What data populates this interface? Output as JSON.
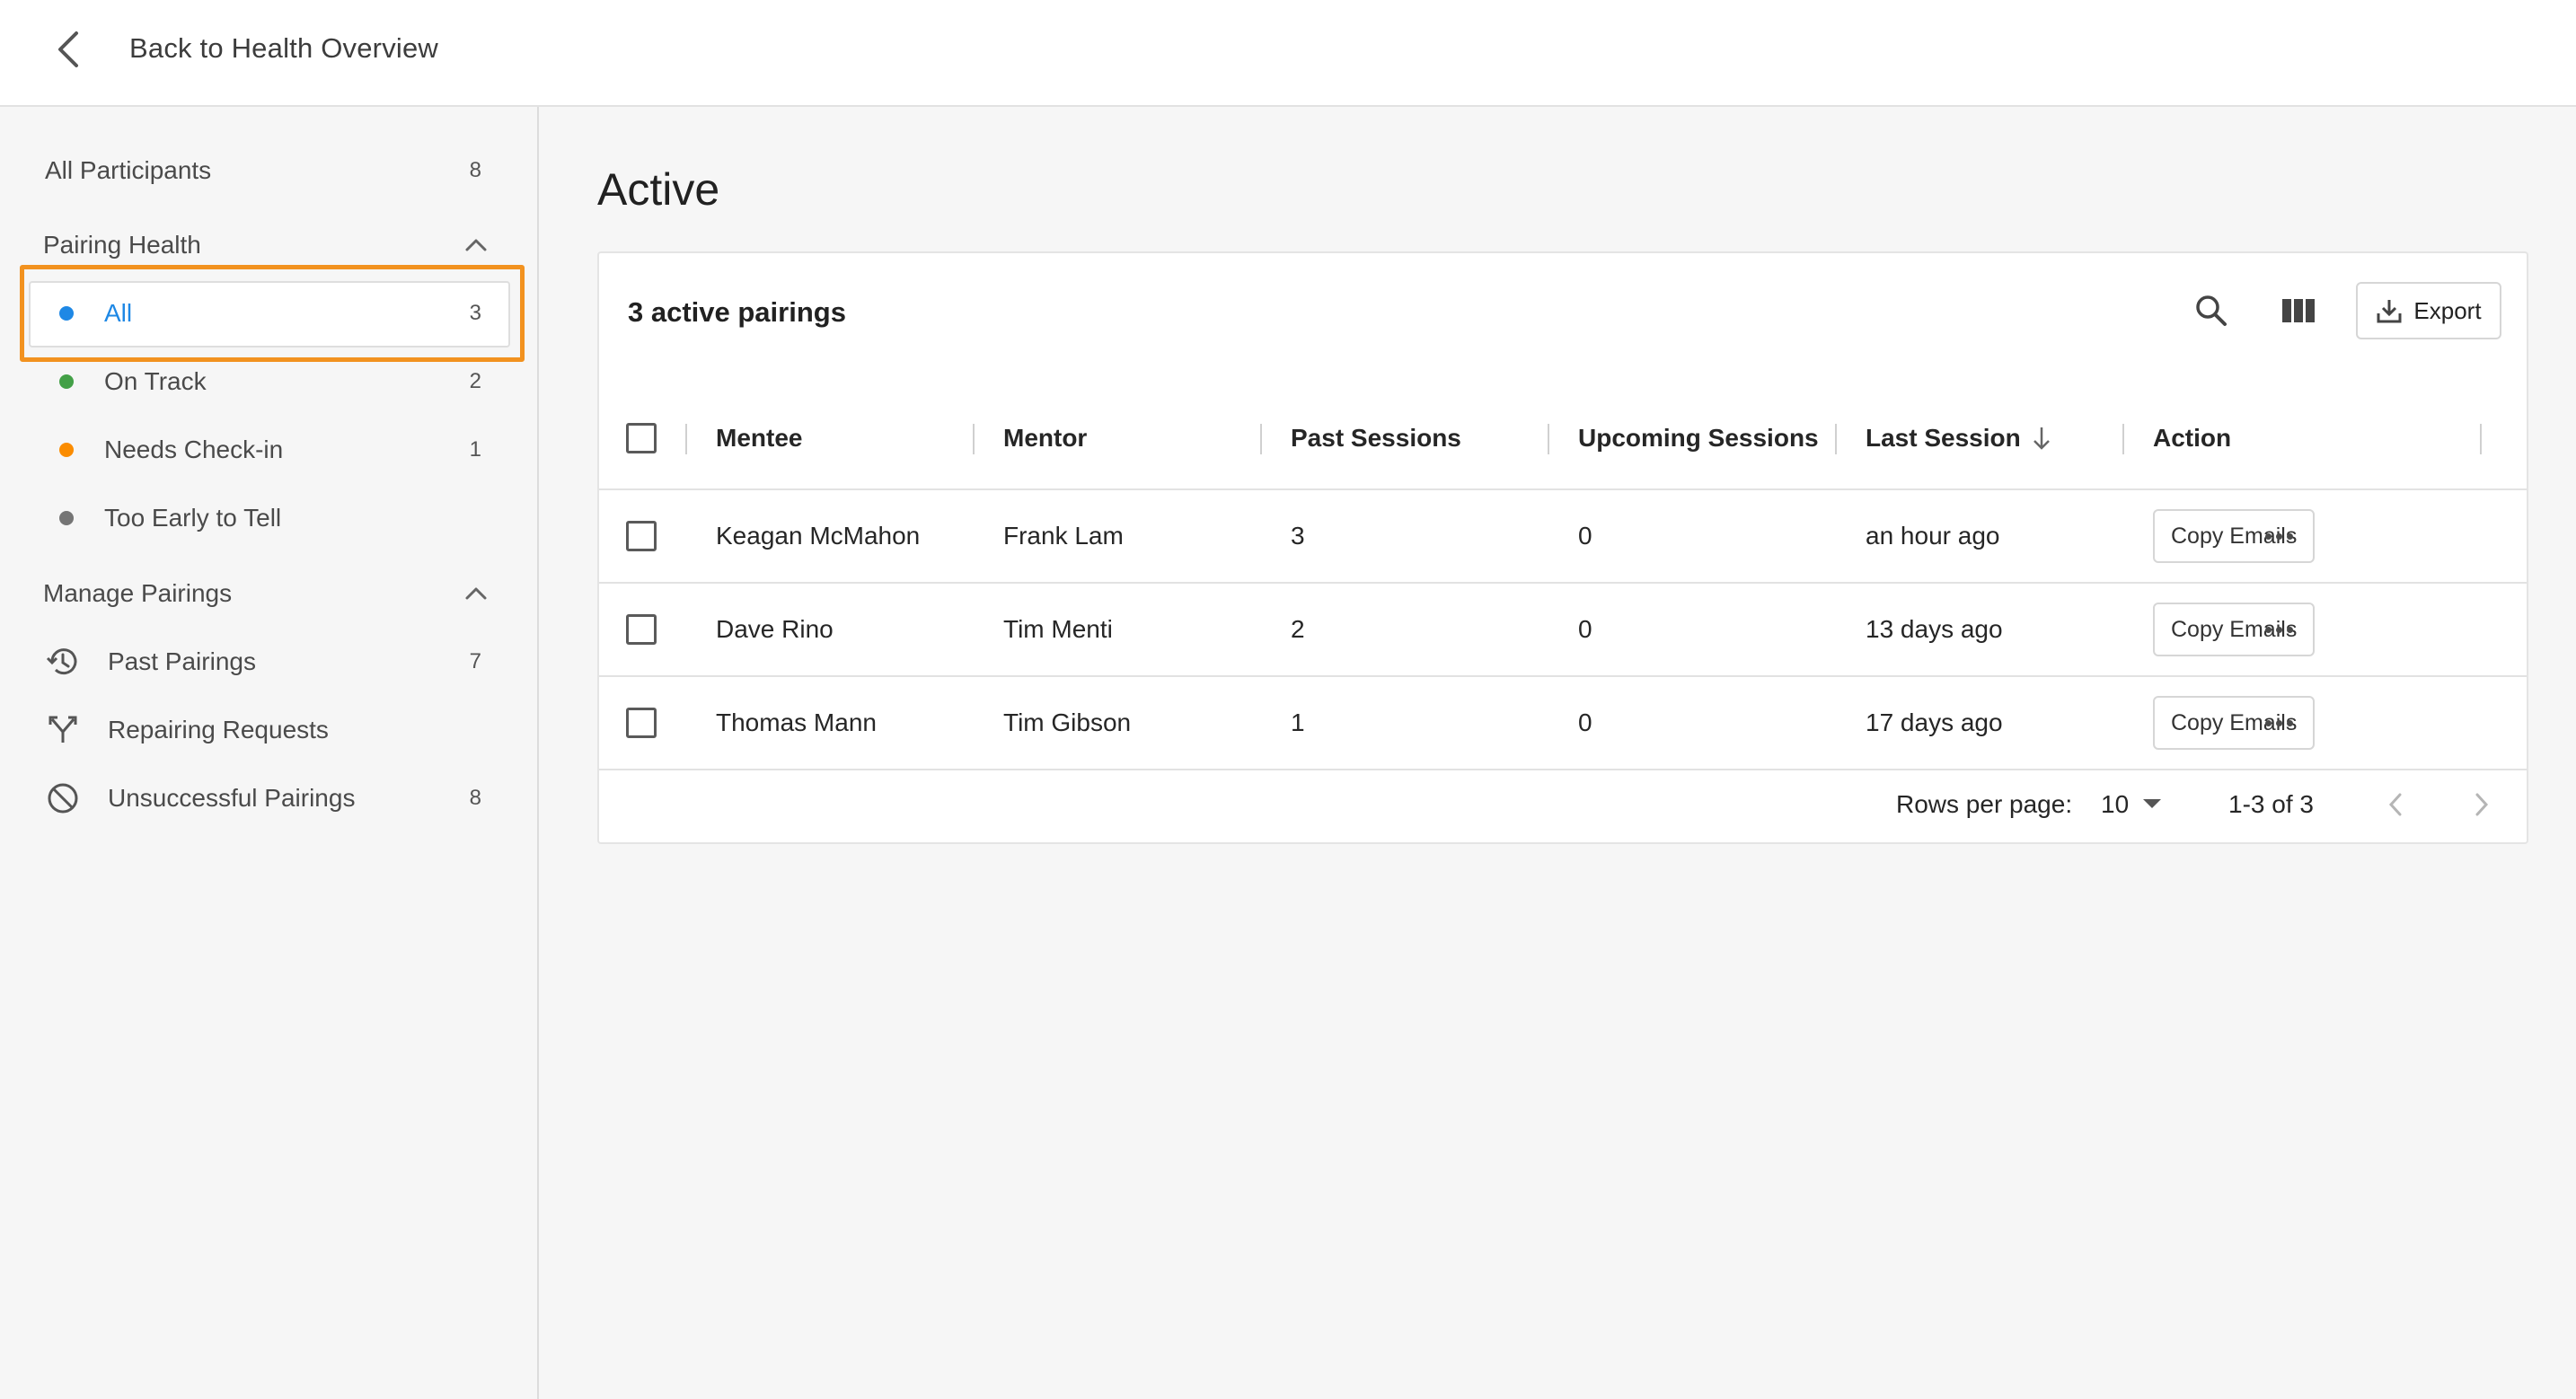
{
  "topbar": {
    "back_label": "Back to Health Overview"
  },
  "sidebar": {
    "all_participants": {
      "label": "All Participants",
      "count": "8"
    },
    "pairing_health": {
      "title": "Pairing Health",
      "items": [
        {
          "label": "All",
          "count": "3",
          "dot_color": "#1e88e5",
          "selected": true
        },
        {
          "label": "On Track",
          "count": "2",
          "dot_color": "#43a047"
        },
        {
          "label": "Needs Check-in",
          "count": "1",
          "dot_color": "#fb8c00"
        },
        {
          "label": "Too Early to Tell",
          "count": "",
          "dot_color": "#757575"
        }
      ]
    },
    "manage_pairings": {
      "title": "Manage Pairings",
      "items": [
        {
          "label": "Past Pairings",
          "count": "7",
          "icon": "history-icon"
        },
        {
          "label": "Repairing Requests",
          "count": "",
          "icon": "merge-icon"
        },
        {
          "label": "Unsuccessful Pairings",
          "count": "8",
          "icon": "block-icon"
        }
      ]
    }
  },
  "main": {
    "title": "Active",
    "card": {
      "title": "3 active pairings",
      "export_label": "Export",
      "columns": [
        "Mentee",
        "Mentor",
        "Past Sessions",
        "Upcoming Sessions",
        "Last Session",
        "Action"
      ],
      "rows": [
        {
          "mentee": "Keagan McMahon",
          "mentor": "Frank Lam",
          "past": "3",
          "upcoming": "0",
          "last": "an hour ago",
          "action": "Copy Emails"
        },
        {
          "mentee": "Dave Rino",
          "mentor": "Tim Menti",
          "past": "2",
          "upcoming": "0",
          "last": "13 days ago",
          "action": "Copy Emails"
        },
        {
          "mentee": "Thomas Mann",
          "mentor": "Tim Gibson",
          "past": "1",
          "upcoming": "0",
          "last": "17 days ago",
          "action": "Copy Emails"
        }
      ],
      "pagination": {
        "rows_per_page_label": "Rows per page:",
        "rows_per_page": "10",
        "range": "1-3 of 3"
      }
    }
  },
  "colors": {
    "accent": "#1e88e5",
    "highlight": "#f2921f"
  }
}
